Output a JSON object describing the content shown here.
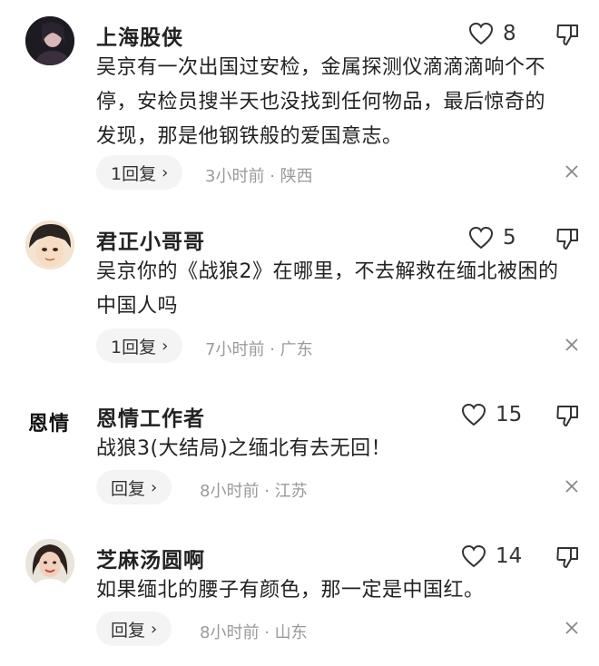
{
  "comments": [
    {
      "username": "上海股侠",
      "likes": "8",
      "text_lines": [
        "吴京有一次出国过安检，金属探测仪滴滴滴响个不",
        "停，安检员搜半天也没找到任何物品，最后惊奇的",
        "发现，那是他钢铁般的爱国意志。"
      ],
      "reply_label": "1回复",
      "time": "3小时前",
      "sep": "·",
      "location": "陕西"
    },
    {
      "username": "君正小哥哥",
      "likes": "5",
      "text_lines": [
        "吴京你的《战狼2》在哪里，不去解救在缅北被困的",
        "中国人吗"
      ],
      "reply_label": "1回复",
      "time": "7小时前",
      "sep": "·",
      "location": "广东"
    },
    {
      "username": "恩情工作者",
      "avatar_text": "恩情",
      "likes": "15",
      "text_lines": [
        "战狼3(大结局)之缅北有去无回！"
      ],
      "reply_label": "回复",
      "time": "8小时前",
      "sep": "·",
      "location": "江苏"
    },
    {
      "username": "芝麻汤圆啊",
      "likes": "14",
      "text_lines": [
        "如果缅北的腰子有颜色，那一定是中国红。"
      ],
      "reply_label": "回复",
      "time": "8小时前",
      "sep": "·",
      "location": "山东"
    }
  ],
  "chevron": "›",
  "close_glyph": "×",
  "colors": {
    "text": "#222222",
    "meta": "#9a9a9a",
    "pill_bg": "#f4f4f4",
    "icon": "#333333"
  }
}
